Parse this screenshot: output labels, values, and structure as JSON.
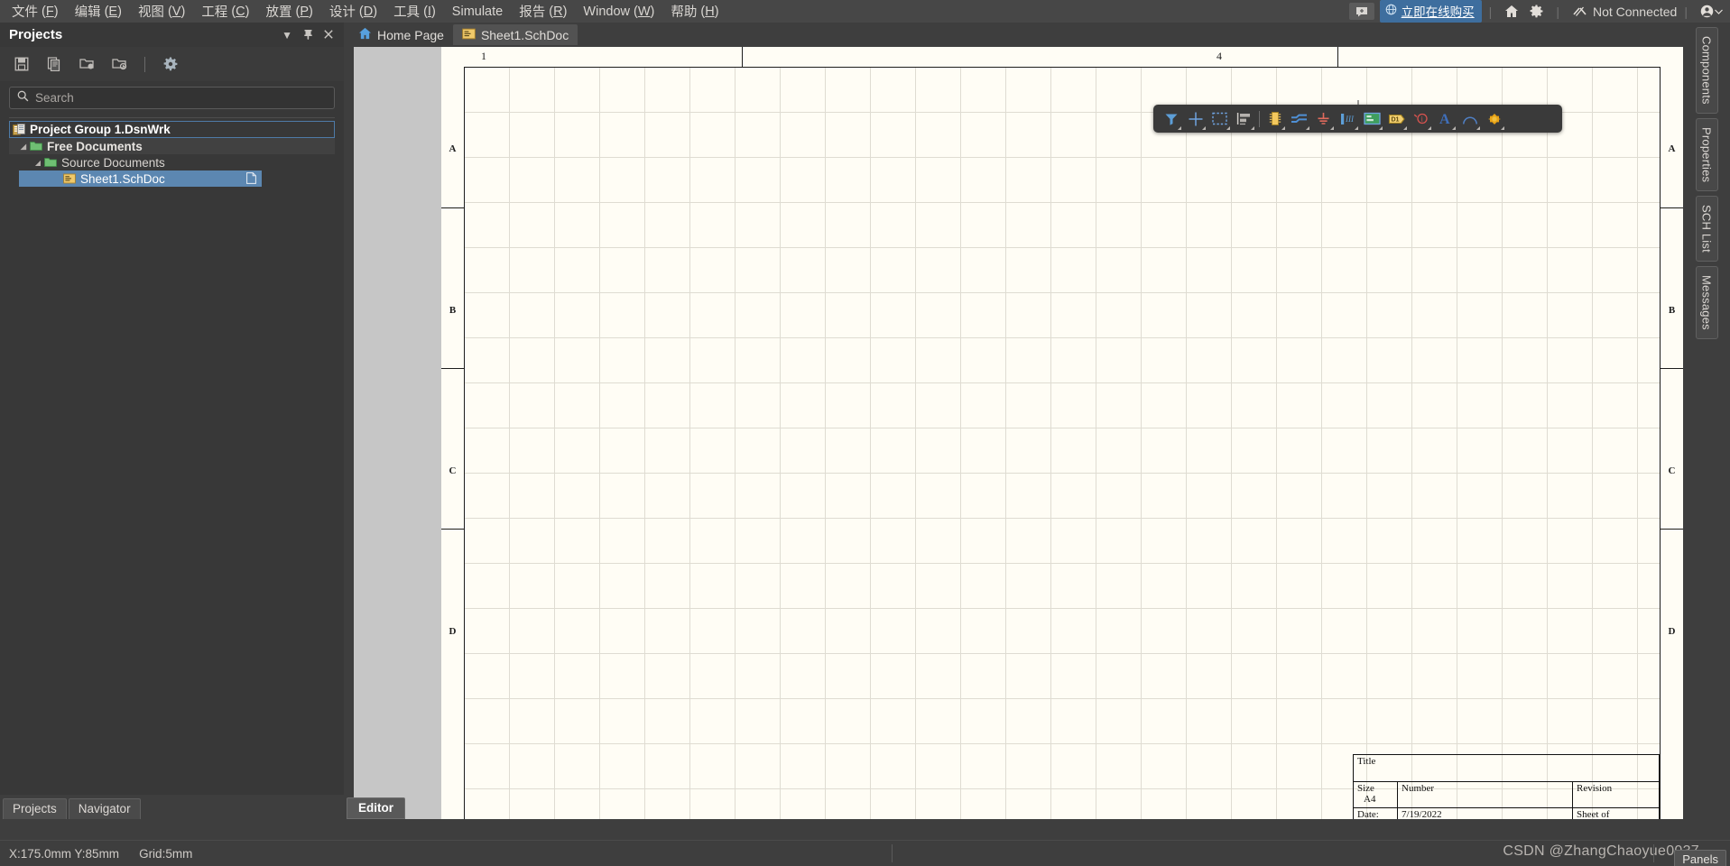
{
  "menubar": {
    "items": [
      {
        "label": "文件",
        "accel": "F"
      },
      {
        "label": "编辑",
        "accel": "E"
      },
      {
        "label": "视图",
        "accel": "V"
      },
      {
        "label": "工程",
        "accel": "C"
      },
      {
        "label": "放置",
        "accel": "P"
      },
      {
        "label": "设计",
        "accel": "D"
      },
      {
        "label": "工具",
        "accel": "I"
      },
      {
        "label": "Simulate",
        "accel": ""
      },
      {
        "label": "报告",
        "accel": "R"
      },
      {
        "label": "Window",
        "accel": "W"
      },
      {
        "label": "帮助",
        "accel": "H"
      }
    ],
    "buy_label": "立即在线购买",
    "connection_status": "Not Connected",
    "icons": {
      "chat": "chat-icon",
      "buy": "globe-icon",
      "home": "home-icon",
      "settings": "gear-icon",
      "connection": "connection-icon",
      "account": "account-icon",
      "account_chevron": "chevron-down-icon"
    }
  },
  "projects_panel": {
    "title": "Projects",
    "title_buttons": [
      "dropdown-arrow",
      "pin",
      "close"
    ],
    "toolbar_icons": [
      "save-icon",
      "compile-icon",
      "open-project-icon",
      "open-folder-icon",
      "gear-icon"
    ],
    "search": {
      "placeholder": "Search",
      "value": "",
      "icon": "search-icon"
    },
    "tree": [
      {
        "label": "Project Group 1.DsnWrk",
        "level": 0,
        "icon": "workspace-icon",
        "state": "root"
      },
      {
        "label": "Free Documents",
        "level": 1,
        "icon": "folder-icon",
        "state": "group",
        "caret": "expanded"
      },
      {
        "label": "Source Documents",
        "level": 2,
        "icon": "folder-icon",
        "state": "normal",
        "caret": "expanded"
      },
      {
        "label": "Sheet1.SchDoc",
        "level": 3,
        "icon": "schdoc-icon",
        "state": "selected",
        "right_icon": "document-icon"
      }
    ],
    "tabs": [
      {
        "label": "Projects",
        "active": true
      },
      {
        "label": "Navigator",
        "active": false
      }
    ]
  },
  "document_tabs": [
    {
      "label": "Home Page",
      "icon": "home-icon",
      "active": false
    },
    {
      "label": "Sheet1.SchDoc",
      "icon": "schdoc-icon",
      "active": true
    }
  ],
  "schematic_toolbar": {
    "buttons": [
      {
        "name": "filter-icon",
        "title": "Filter"
      },
      {
        "name": "crosshair-icon",
        "title": "Cross Probe"
      },
      {
        "name": "selection-icon",
        "title": "Selection"
      },
      {
        "name": "align-icon",
        "title": "Align"
      },
      {
        "name": "component-icon",
        "title": "Place Part"
      },
      {
        "name": "wire-icon",
        "title": "Place Wire"
      },
      {
        "name": "ground-icon",
        "title": "Place GND Power Port"
      },
      {
        "name": "port-icon",
        "title": "Place Net Label"
      },
      {
        "name": "sheet-symbol-icon",
        "title": "Place Sheet Symbol"
      },
      {
        "name": "sheet-entry-icon",
        "title": "Place Sheet Entry"
      },
      {
        "name": "no-erc-icon",
        "title": "Place No ERC"
      },
      {
        "name": "text-icon",
        "title": "Place Text String"
      },
      {
        "name": "arc-icon",
        "title": "Place Arc"
      },
      {
        "name": "junction-icon",
        "title": "Place Junction"
      }
    ],
    "separator_after_index": 3
  },
  "sheet": {
    "column_labels": [
      "1",
      "4"
    ],
    "row_labels": [
      "A",
      "B",
      "C",
      "D"
    ],
    "title_block": {
      "title_label": "Title",
      "title_value": "",
      "size_label": "Size",
      "size_value": "A4",
      "number_label": "Number",
      "number_value": "",
      "revision_label": "Revision",
      "revision_value": "",
      "date_label": "Date:",
      "date_value": "7/19/2022",
      "sheet_label": "Sheet  of"
    }
  },
  "right_rail": {
    "tabs": [
      "Components",
      "Properties",
      "SCH List",
      "Messages"
    ]
  },
  "bottom": {
    "editor_tab": "Editor",
    "status_coords": "X:175.0mm Y:85mm",
    "status_grid": "Grid:5mm",
    "watermark": "CSDN @ZhangChaoyue0037",
    "panels_button": "Panels"
  },
  "colors": {
    "accent_blue": "#3e6e9e",
    "selection_blue": "#5c87b1",
    "paper": "#fffdf5",
    "canvas_gray": "#c6c6c6",
    "chrome_dark": "#3e3e3e"
  }
}
